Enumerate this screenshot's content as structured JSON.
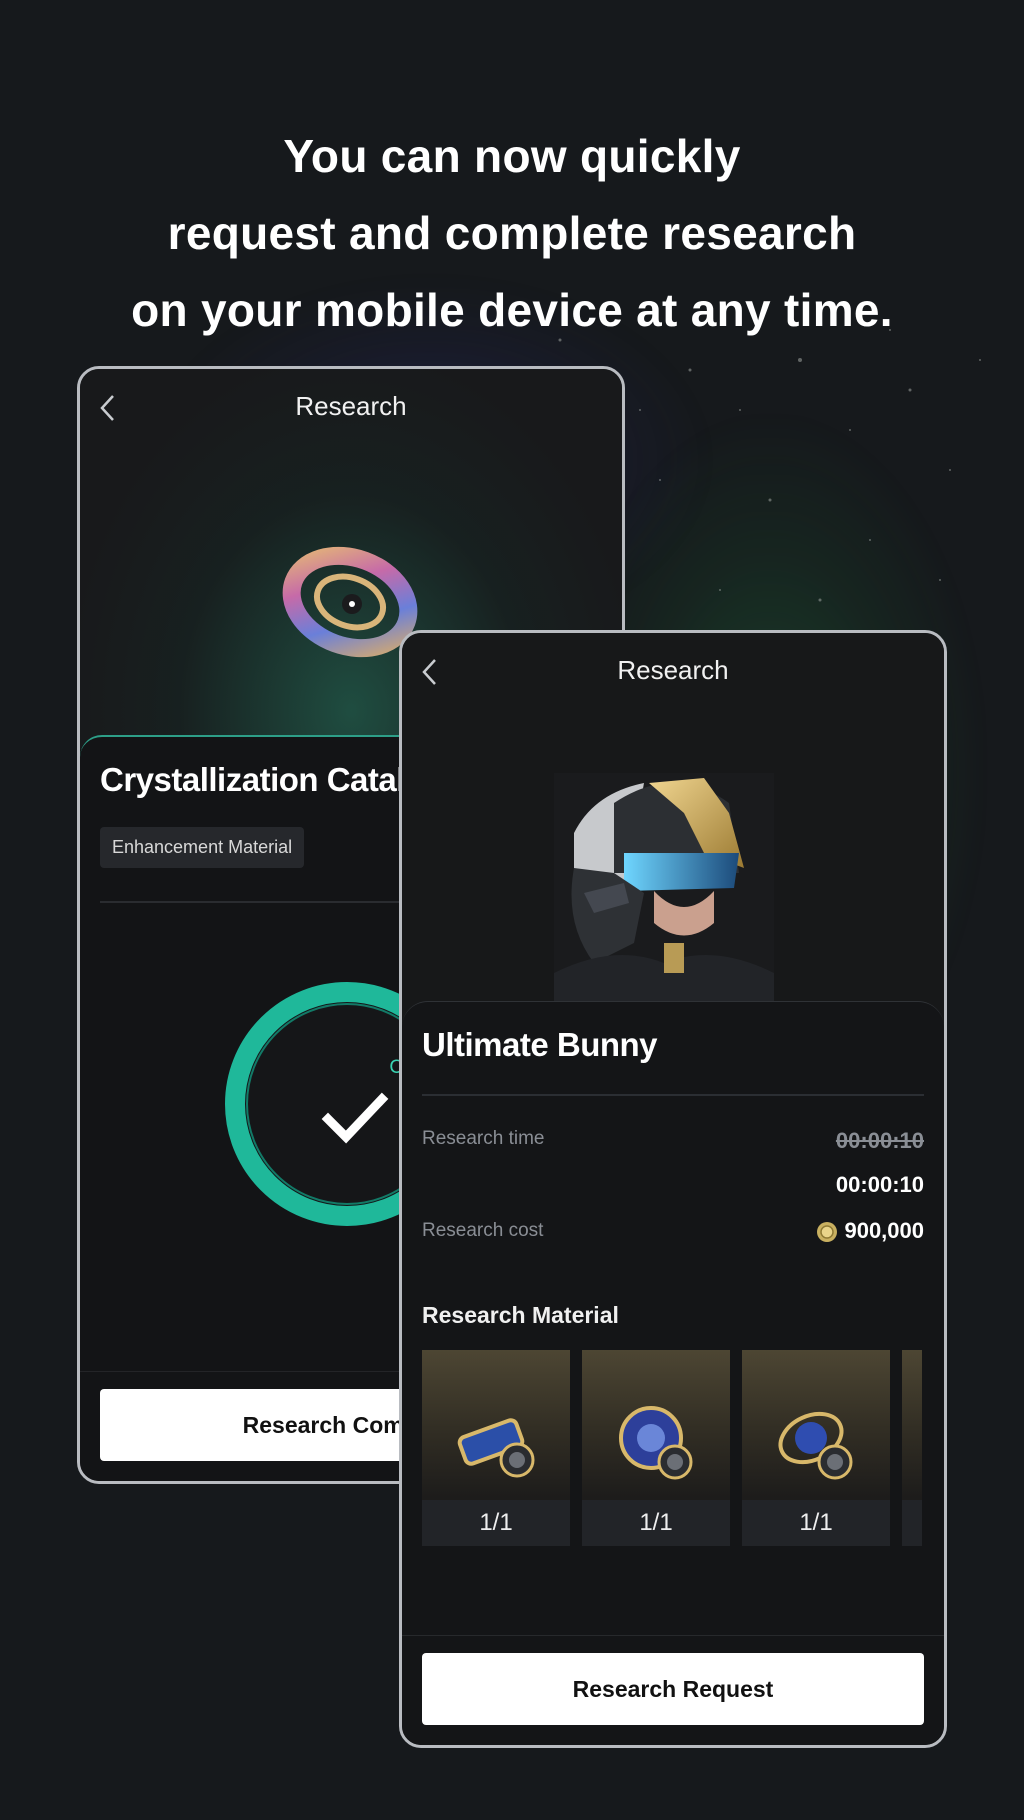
{
  "headline": {
    "line1": "You can now quickly",
    "line2": "request and complete research",
    "line3": "on your mobile device at any time."
  },
  "back_screen": {
    "title": "Research",
    "item_name": "Crystallization Catalyst",
    "tag": "Enhancement Material",
    "status": "Complete",
    "progress": 1.0,
    "button_label": "Research Complete"
  },
  "front_screen": {
    "title": "Research",
    "unit_name": "Ultimate Bunny",
    "research_time_label": "Research time",
    "research_time_original": "00:00:10",
    "research_time_current": "00:00:10",
    "research_cost_label": "Research cost",
    "research_cost_value": "900,000",
    "materials_title": "Research Material",
    "materials": [
      {
        "icon": "capsule-icon",
        "count": "1/1"
      },
      {
        "icon": "disc-icon",
        "count": "1/1"
      },
      {
        "icon": "gyro-icon",
        "count": "1/1"
      }
    ],
    "button_label": "Research Request"
  },
  "colors": {
    "accent_teal": "#2fd3b1",
    "background": "#16191c"
  }
}
